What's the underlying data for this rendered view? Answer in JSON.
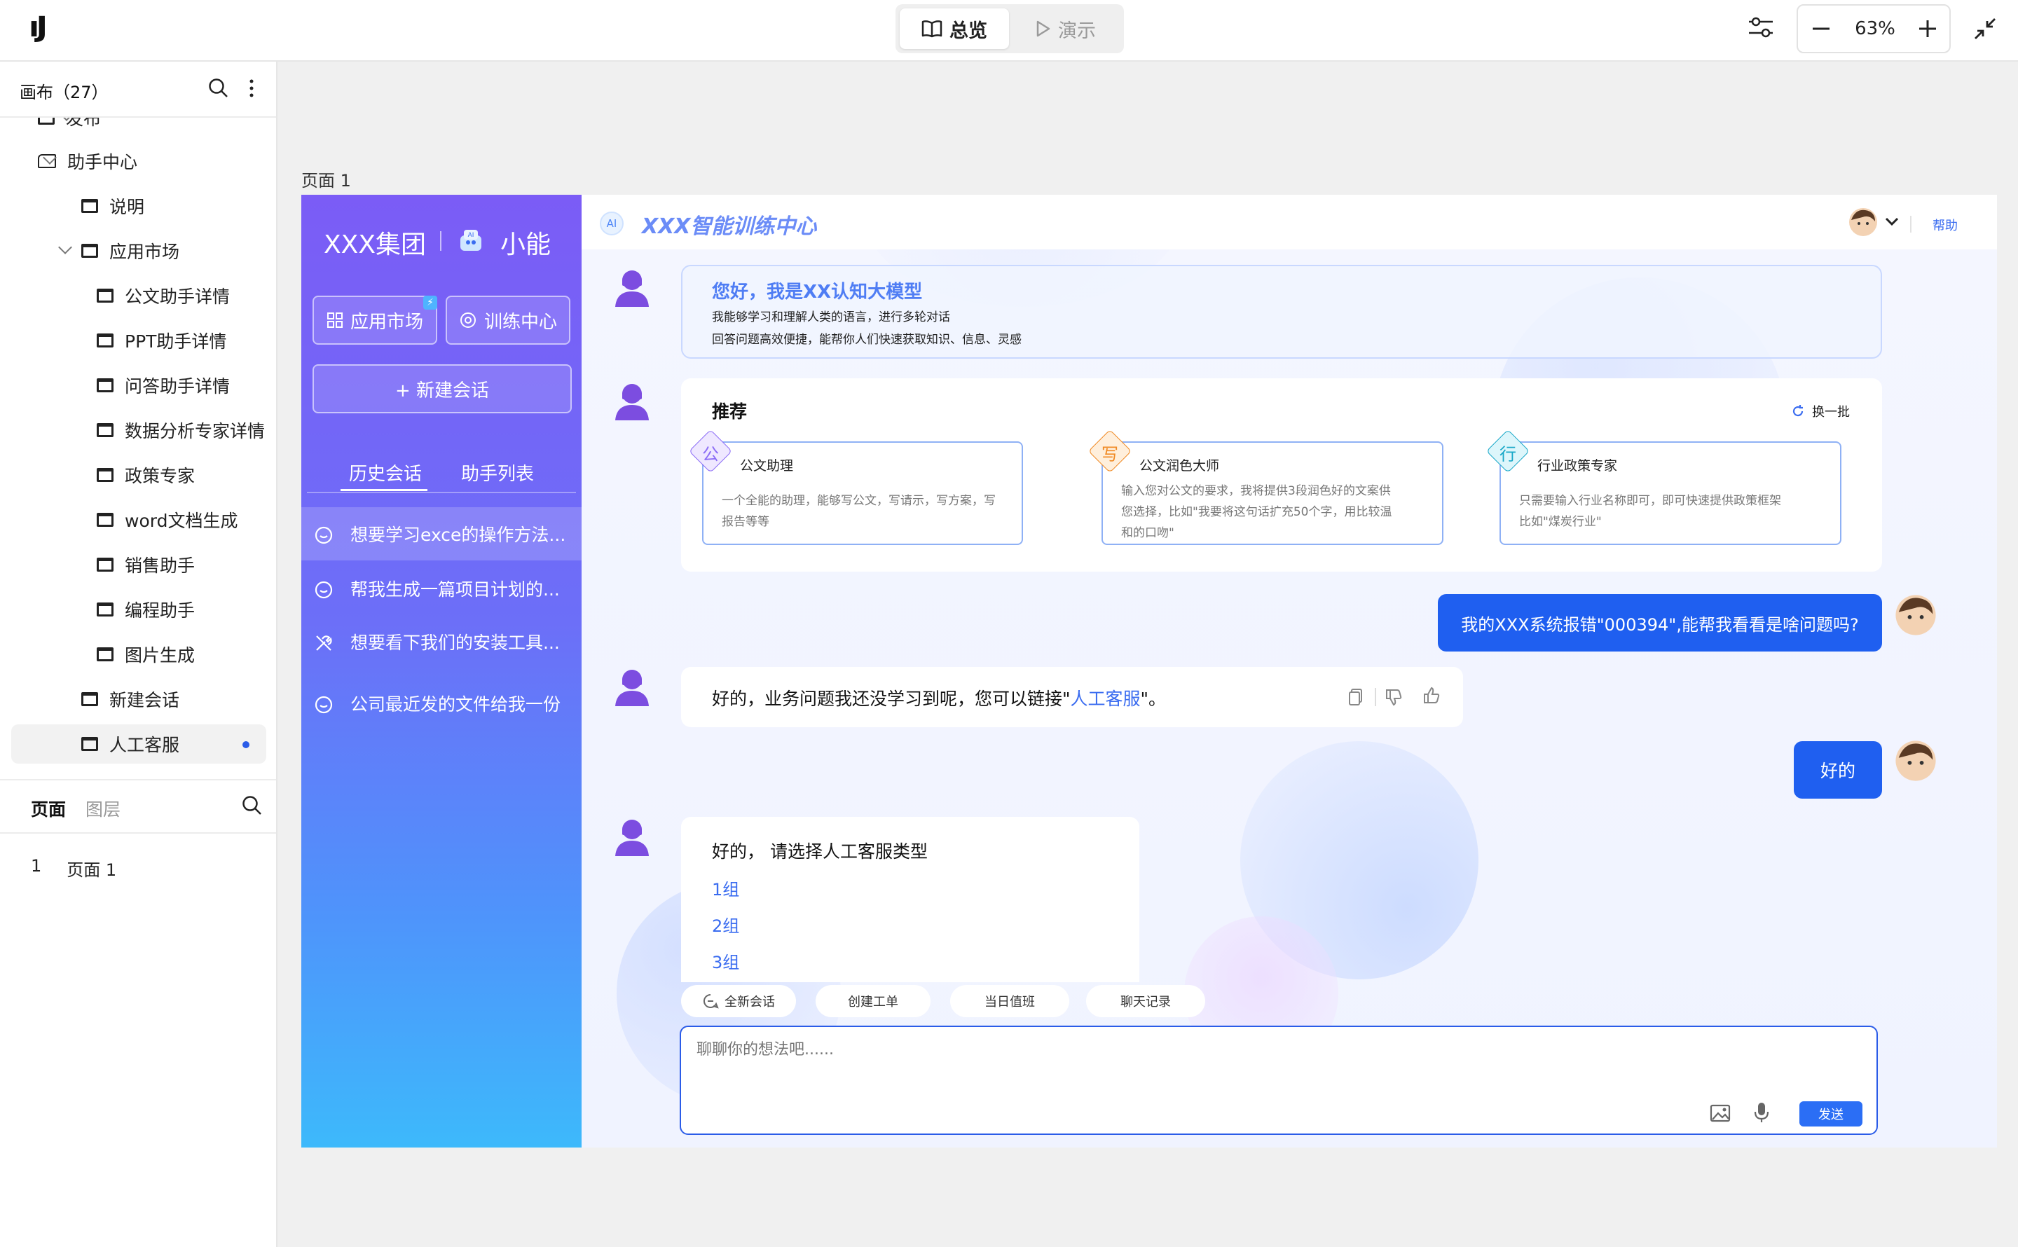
{
  "topbar": {
    "logo": "ıJ",
    "overview_label": "总览",
    "demo_label": "演示",
    "zoom": "63%"
  },
  "panel": {
    "title": "画布（27）",
    "tree": [
      {
        "label": "发布",
        "level": 1
      },
      {
        "label": "助手中心",
        "level": 1
      },
      {
        "label": "说明",
        "level": 2
      },
      {
        "label": "应用市场",
        "level": 2
      },
      {
        "label": "公文助手详情",
        "level": 3
      },
      {
        "label": "PPT助手详情",
        "level": 3
      },
      {
        "label": "问答助手详情",
        "level": 3
      },
      {
        "label": "数据分析专家详情",
        "level": 3
      },
      {
        "label": "政策专家",
        "level": 3
      },
      {
        "label": "word文档生成",
        "level": 3
      },
      {
        "label": "销售助手",
        "level": 3
      },
      {
        "label": "编程助手",
        "level": 3
      },
      {
        "label": "图片生成",
        "level": 3
      },
      {
        "label": "新建会话",
        "level": 2
      },
      {
        "label": "人工客服",
        "level": 2
      }
    ],
    "tabs": {
      "pages": "页面",
      "layers": "图层"
    },
    "page_list": [
      {
        "index": "1",
        "name": "页面 1"
      }
    ]
  },
  "canvas": {
    "page_label": "页面 1"
  },
  "app": {
    "brand": "XXX集团",
    "bot_name": "小能",
    "market_btn": "应用市场",
    "training_btn": "训练中心",
    "new_chat_btn": "+ 新建会话",
    "tab_history": "历史会话",
    "tab_assistants": "助手列表",
    "history": [
      "想要学习exce的操作方法...",
      "帮我生成一篇项目计划的...",
      "想要看下我们的安装工具...",
      "公司最近发的文件给我一份"
    ],
    "header_title": "XXX智能训练中心",
    "ai_badge": "AI",
    "help": "帮助",
    "welcome": {
      "title": "您好，我是XX认知大模型",
      "line1": "我能够学习和理解人类的语言，进行多轮对话",
      "line2": "回答问题高效便捷，能帮你人们快速获取知识、信息、灵感"
    },
    "recommend": {
      "title": "推荐",
      "refresh": "换一批",
      "cards": [
        {
          "badge": "公",
          "title": "公文助理",
          "desc": [
            "一个全能的助理，能够写公文，写请示，写方案，写",
            "报告等等"
          ],
          "color": "#8b6cf6",
          "bg": "#efe8ff"
        },
        {
          "badge": "写",
          "title": "公文润色大师",
          "desc": [
            "输入您对公文的要求，我将提供3段润色好的文案供",
            "您选择，比如\"我要将这句话扩充50个字，用比较温",
            "和的口吻\""
          ],
          "color": "#f08a24",
          "bg": "#ffefdc"
        },
        {
          "badge": "行",
          "title": "行业政策专家",
          "desc": [
            "只需要输入行业名称即可，即可快速提供政策框架",
            "比如\"煤炭行业\""
          ],
          "color": "#19a8c8",
          "bg": "#ddf6fb"
        }
      ]
    },
    "msg_user1": "我的XXX系统报错\"000394\",能帮我看看是啥问题吗?",
    "msg_bot1_pre": "好的，业务问题我还没学习到呢，您可以链接\"",
    "msg_bot1_link": "人工客服",
    "msg_bot1_post": "\"。",
    "msg_user2": "好的",
    "msg_bot2": {
      "title": "好的， 请选择人工客服类型",
      "options": [
        "1组",
        "2组",
        "3组"
      ]
    },
    "quick_actions": [
      "全新会话",
      "创建工单",
      "当日值班",
      "聊天记录"
    ],
    "input_placeholder": "聊聊你的想法吧......",
    "send": "发送"
  },
  "colors": {
    "accent": "#1f5ff0",
    "sidebar_top": "#7b5cf6",
    "sidebar_bottom": "#3db9fb"
  }
}
